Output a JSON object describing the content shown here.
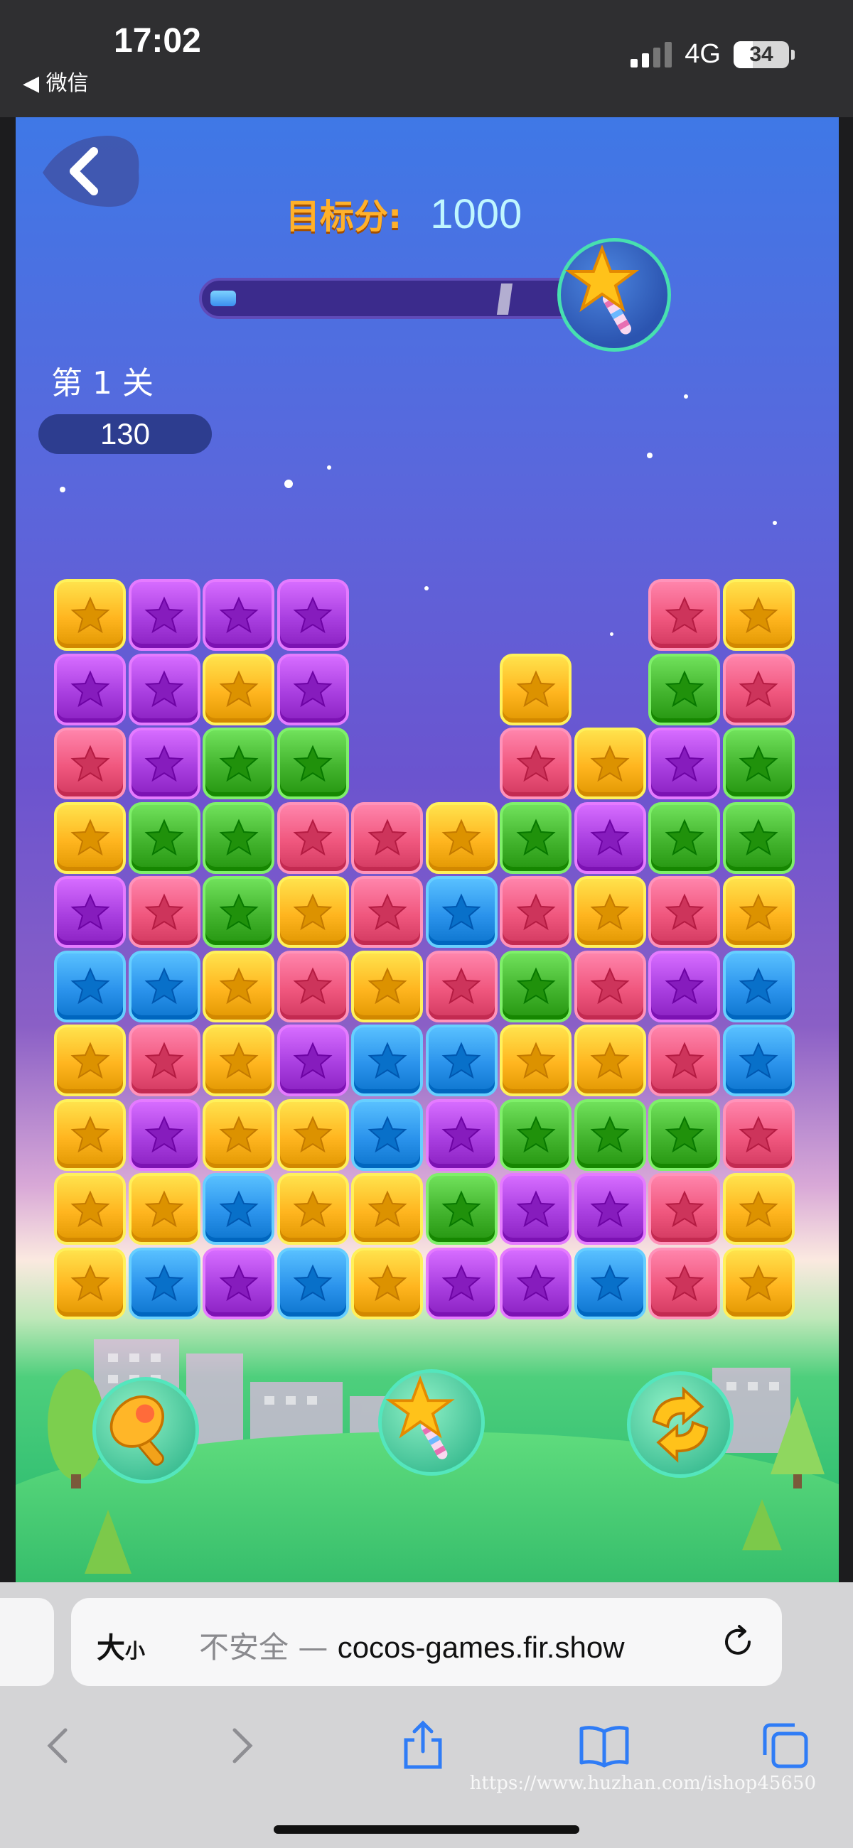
{
  "status": {
    "time": "17:02",
    "back_label": "◀ 微信",
    "network": "4G",
    "battery": "34",
    "battery_fill": 0.34
  },
  "game": {
    "target_label": "目标分:",
    "target_value": "1000",
    "progress_fraction": 0.07,
    "level_label": "第 1 关",
    "score": "130",
    "board": {
      "cols": 10,
      "rows": 10,
      "cells": [
        [
          "Y",
          "P",
          "P",
          "P",
          ".",
          ".",
          ".",
          ".",
          "R",
          "Y"
        ],
        [
          "P",
          "P",
          "Y",
          "P",
          ".",
          ".",
          "Y",
          ".",
          "G",
          "R"
        ],
        [
          "R",
          "P",
          "G",
          "G",
          ".",
          ".",
          "R",
          "Y",
          "P",
          "G"
        ],
        [
          "Y",
          "G",
          "G",
          "R",
          "R",
          "Y",
          "G",
          "P",
          "G",
          "G"
        ],
        [
          "P",
          "R",
          "G",
          "Y",
          "R",
          "B",
          "R",
          "Y",
          "R",
          "Y"
        ],
        [
          "B",
          "B",
          "Y",
          "R",
          "Y",
          "R",
          "G",
          "R",
          "P",
          "B"
        ],
        [
          "Y",
          "R",
          "Y",
          "P",
          "B",
          "B",
          "Y",
          "Y",
          "R",
          "B"
        ],
        [
          "Y",
          "P",
          "Y",
          "Y",
          "B",
          "P",
          "G",
          "G",
          "G",
          "R"
        ],
        [
          "Y",
          "Y",
          "B",
          "Y",
          "Y",
          "G",
          "P",
          "P",
          "R",
          "Y"
        ],
        [
          "Y",
          "B",
          "P",
          "B",
          "Y",
          "P",
          "P",
          "B",
          "R",
          "Y"
        ]
      ]
    },
    "colors": {
      "Y": "#ffb51f",
      "P": "#a93fe0",
      "R": "#f0577e",
      "G": "#43b42e",
      "B": "#2b93ec"
    },
    "tools": [
      "hammer-icon",
      "magic-wand-icon",
      "refresh-icon"
    ]
  },
  "browser": {
    "text_size": "大",
    "text_size_small": "小",
    "insecure": "不安全 — ",
    "domain": "cocos-games.fir.show",
    "watermark": "https://www.huzhan.com/ishop45650"
  }
}
